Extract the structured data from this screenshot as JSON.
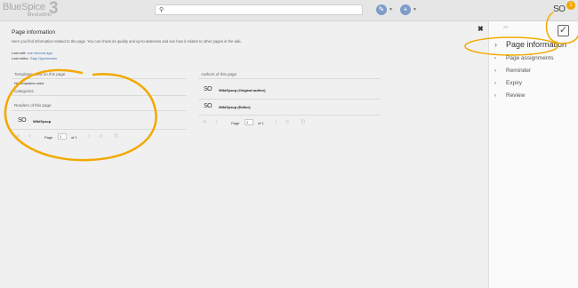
{
  "topbar": {
    "logo_main": "BlueSpice",
    "logo_sub": "MediaWiki",
    "logo_version": "3",
    "search_placeholder": "",
    "user_initials": "SO",
    "notification_count": "1"
  },
  "main": {
    "title": "Page information",
    "description": "Here you find information related to the page. You can check its quality and up-to-dateness and see how it relates to other pages in the wiki.",
    "last_edit_label": "Last edit:",
    "last_edit_value": "one second ago",
    "last_editor_label": "Last editor:",
    "last_editor_value": "Stay Oppermann",
    "templates_header": "Templates used on this page",
    "no_templates": "No templates used",
    "categories_header": "Categories",
    "readers_header": "Readers of this page",
    "readers": [
      {
        "initials": "SO",
        "name": "WikiSysop"
      }
    ],
    "authors_header": "Authors of this page",
    "authors": [
      {
        "initials": "SO",
        "name": "WikiSysop (Original author)"
      },
      {
        "initials": "SO",
        "name": "WikiSysop (Editor)"
      }
    ],
    "pager_page_label": "Page",
    "pager_page_value": "1",
    "pager_of_label": "of 1"
  },
  "sidebar": {
    "items": [
      {
        "label": "Page information",
        "chevron": "›",
        "active": true
      },
      {
        "label": "Page assignments",
        "chevron": "‹"
      },
      {
        "label": "Reminder",
        "chevron": "‹"
      },
      {
        "label": "Expiry",
        "chevron": "‹"
      },
      {
        "label": "Review",
        "chevron": "‹"
      }
    ]
  },
  "colors": {
    "highlight": "#f2a900",
    "link": "#3e6db0",
    "toolbar_button": "#7e9cc7"
  }
}
